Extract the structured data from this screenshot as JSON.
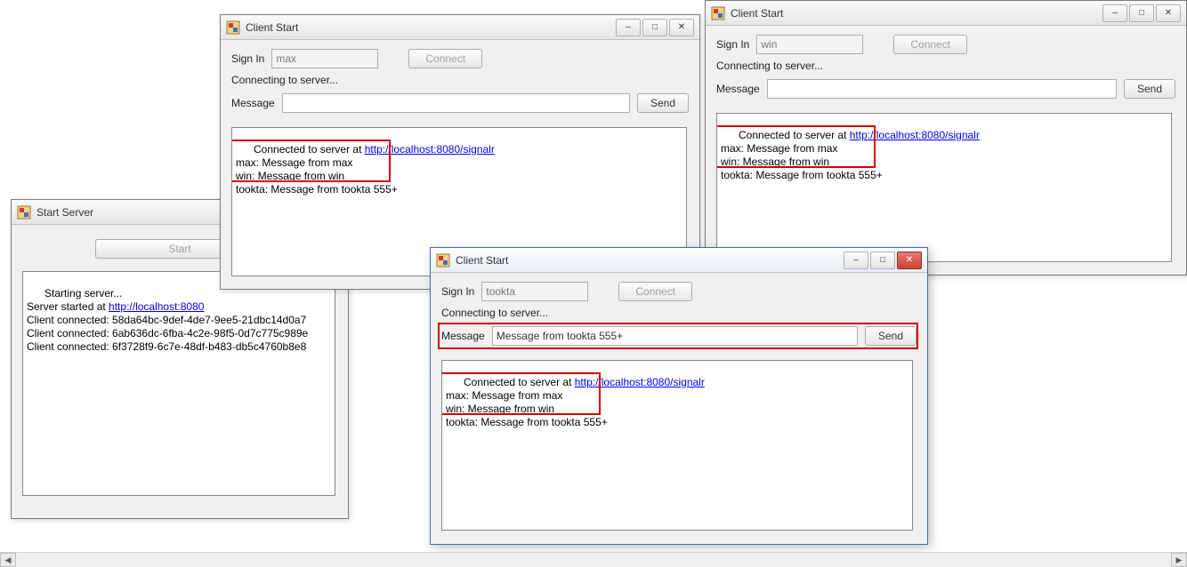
{
  "icons": {
    "app": "app-icon",
    "minimize": "–",
    "maximize": "□",
    "close": "✕",
    "scroll_left": "◀",
    "scroll_right": "▶"
  },
  "server_window": {
    "title": "Start Server",
    "start_button": "Start",
    "log_before_url": "Starting server...\nServer started at ",
    "log_url": "http://localhost:8080",
    "log_after_url": "\nClient connected: 58da64bc-9def-4de7-9ee5-21dbc14d0a7\nClient connected: 6ab636dc-6fba-4c2e-98f5-0d7c775c989e\nClient connected: 6f3728f9-6c7e-48df-b483-db5c4760b8e8"
  },
  "client_common": {
    "title": "Client Start",
    "signin_label": "Sign In",
    "connect_button": "Connect",
    "status": "Connecting to server...",
    "message_label": "Message",
    "send_button": "Send",
    "log_prefix": "Connected to server at ",
    "log_url": "http://localhost:8080/signalr",
    "log_messages": "\nmax: Message from max\nwin: Message from win\ntookta: Message from tookta 555+"
  },
  "client_max": {
    "signin_value": "max",
    "message_value": ""
  },
  "client_win": {
    "signin_value": "win",
    "message_value": ""
  },
  "client_tookta": {
    "signin_value": "tookta",
    "message_value": "Message from tookta 555+"
  }
}
